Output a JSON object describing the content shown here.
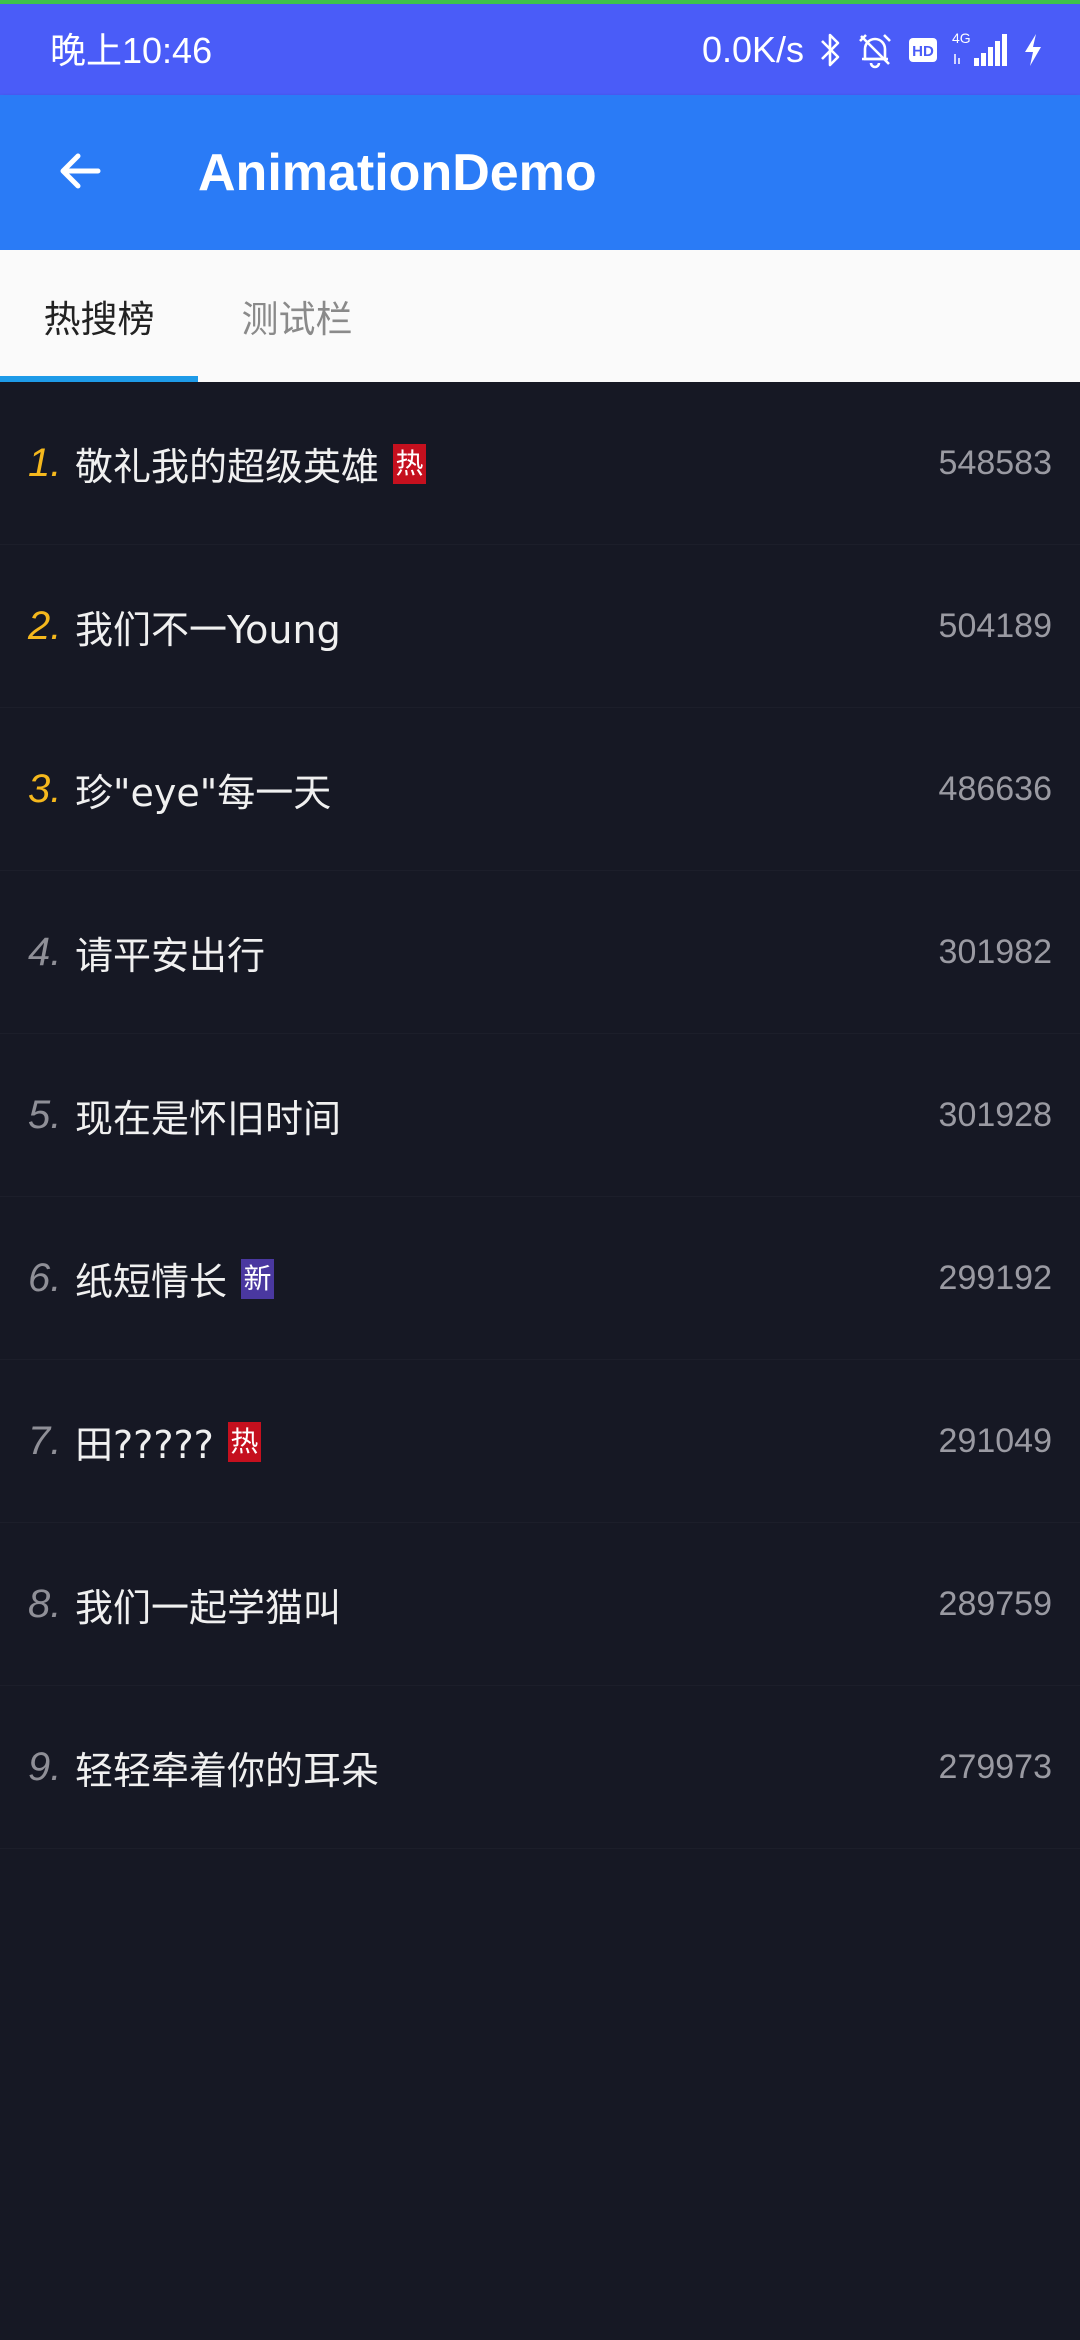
{
  "status_bar": {
    "time": "晚上10:46",
    "net_speed": "0.0K/s",
    "icons": [
      "bluetooth-icon",
      "alarm-off-icon",
      "hd-icon",
      "signal-4g-icon",
      "charging-icon"
    ],
    "hd_label": "HD",
    "network_label": "4G"
  },
  "app_bar": {
    "title": "AnimationDemo",
    "back_icon": "arrow-left-icon"
  },
  "tabs": [
    {
      "label": "热搜榜",
      "selected": true
    },
    {
      "label": "测试栏",
      "selected": false
    }
  ],
  "list": [
    {
      "rank": "1.",
      "title": "敬礼我的超级英雄",
      "badge": "热",
      "badge_type": "hot",
      "heat": "548583"
    },
    {
      "rank": "2.",
      "title": "我们不一Young",
      "badge": null,
      "badge_type": null,
      "heat": "504189"
    },
    {
      "rank": "3.",
      "title": "珍\"eye\"每一天",
      "badge": null,
      "badge_type": null,
      "heat": "486636"
    },
    {
      "rank": "4.",
      "title": "请平安出行",
      "badge": null,
      "badge_type": null,
      "heat": "301982"
    },
    {
      "rank": "5.",
      "title": "现在是怀旧时间",
      "badge": null,
      "badge_type": null,
      "heat": "301928"
    },
    {
      "rank": "6.",
      "title": "纸短情长",
      "badge": "新",
      "badge_type": "new",
      "heat": "299192"
    },
    {
      "rank": "7.",
      "title": "田?????",
      "badge": "热",
      "badge_type": "hot",
      "heat": "291049"
    },
    {
      "rank": "8.",
      "title": "我们一起学猫叫",
      "badge": null,
      "badge_type": null,
      "heat": "289759"
    },
    {
      "rank": "9.",
      "title": "轻轻牵着你的耳朵",
      "badge": null,
      "badge_type": null,
      "heat": "279973"
    }
  ],
  "colors": {
    "status_bar": "#4a5cf8",
    "app_bar": "#2a7bf6",
    "background": "#161824",
    "rank_top": "#f5b81d",
    "badge_hot": "#c5101e",
    "badge_new": "#4a38a0",
    "tab_indicator": "#1e9be8"
  }
}
